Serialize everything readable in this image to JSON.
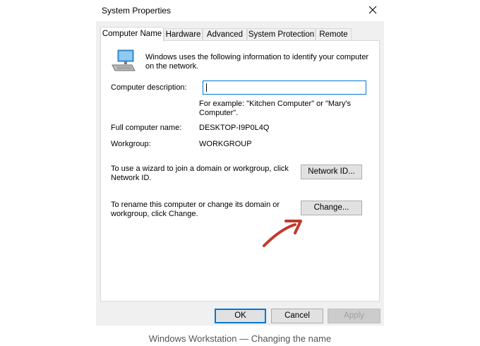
{
  "window": {
    "title": "System Properties"
  },
  "tabs": [
    {
      "label": "Computer Name",
      "active": true
    },
    {
      "label": "Hardware",
      "active": false
    },
    {
      "label": "Advanced",
      "active": false
    },
    {
      "label": "System Protection",
      "active": false
    },
    {
      "label": "Remote",
      "active": false
    }
  ],
  "panel": {
    "intro_line1": "Windows uses the following information to identify your computer",
    "intro_line2": "on the network.",
    "description_label": "Computer description:",
    "description_value": "",
    "example_line1": "For example: \"Kitchen Computer\" or \"Mary's",
    "example_line2": "Computer\".",
    "full_name_label": "Full computer name:",
    "full_name_value": "DESKTOP-I9P0L4Q",
    "workgroup_label": "Workgroup:",
    "workgroup_value": "WORKGROUP",
    "wizard_text_line1": "To use a wizard to join a domain or workgroup, click",
    "wizard_text_line2": "Network ID.",
    "network_id_label": "Network ID...",
    "rename_text_line1": "To rename this computer or change its domain or",
    "rename_text_line2": "workgroup, click Change.",
    "change_label": "Change..."
  },
  "footer": {
    "ok_label": "OK",
    "cancel_label": "Cancel",
    "apply_label": "Apply"
  },
  "caption": "Windows Workstation — Changing the name",
  "icons": [
    "computer-icon",
    "close-icon",
    "red-arrow-annotation"
  ],
  "colors": {
    "focus_blue": "#0078d7",
    "annotation_red": "#c0392b"
  }
}
